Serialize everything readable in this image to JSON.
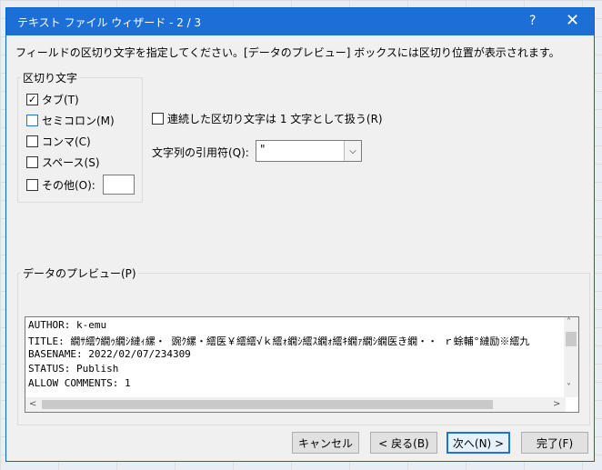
{
  "window": {
    "title": "テキスト ファイル ウィザード - 2 / 3",
    "help": "?",
    "close": "✕"
  },
  "instruction": "フィールドの区切り文字を指定してください。[データのプレビュー] ボックスには区切り位置が表示されます。",
  "delimiters": {
    "group_label": "区切り文字",
    "tab": {
      "label": "タブ(T)",
      "checked": true
    },
    "semicolon": {
      "label": "セミコロン(M)",
      "checked": false
    },
    "comma": {
      "label": "コンマ(C)",
      "checked": false
    },
    "space": {
      "label": "スペース(S)",
      "checked": false
    },
    "other": {
      "label": "その他(O):",
      "checked": false,
      "value": ""
    }
  },
  "consecutive": {
    "label": "連続した区切り文字は 1 文字として扱う(R)",
    "checked": false
  },
  "qualifier": {
    "label": "文字列の引用符(Q):",
    "value": "\""
  },
  "preview": {
    "label": "データのプレビュー(P)",
    "lines": [
      "AUTHOR: k-emu",
      "TITLE: 繝ｻ繧ｳ繝ｩ繝ｼ縺ｨ縲・ 豌ｸ縲・繧医￥繧繧√ｋ繧ｫ繝ｼ繧ｽ繝ｫ繧ｷ繝ｧ繝ｼ繝医き繝・・ ｒ蜍輔°縺励※繧九",
      "BASENAME: 2022/02/07/234309",
      "STATUS: Publish",
      "ALLOW COMMENTS: 1"
    ]
  },
  "buttons": {
    "cancel": "キャンセル",
    "back": "< 戻る(B)",
    "next": "次へ(N) >",
    "finish": "完了(F)"
  }
}
